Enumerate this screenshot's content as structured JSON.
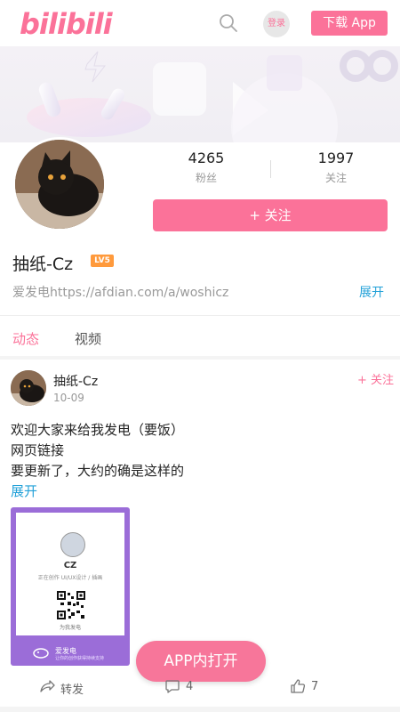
{
  "header": {
    "logo_text": "bilibili",
    "login_label": "登录",
    "download_label": "下载 App"
  },
  "profile": {
    "fans_count": "4265",
    "fans_label": "粉丝",
    "following_count": "1997",
    "following_label": "关注",
    "follow_button": "+ 关注",
    "username": "抽纸-Cz",
    "level": "LV5",
    "bio": "爱发电https://afdian.com/a/woshicz",
    "expand_label": "展开"
  },
  "tabs": [
    {
      "label": "动态",
      "active": true
    },
    {
      "label": "视频",
      "active": false
    }
  ],
  "post": {
    "author": "抽纸-Cz",
    "date": "10-09",
    "follow_label": "+ 关注",
    "lines": [
      "欢迎大家来给我发电（要饭）",
      "网页链接",
      "要更新了，大约的确是这样的"
    ],
    "expand_label": "展开",
    "card": {
      "name": "CZ",
      "subtitle": "正在创作 UI/UX设计 / 插画",
      "caption": "为我发电",
      "footer_title": "爱发电",
      "footer_sub": "让你的创作获得持续支持"
    },
    "actions": {
      "share_label": "转发",
      "comment_count": "4",
      "like_count": "7"
    }
  },
  "app_open_label": "APP内打开",
  "colors": {
    "brand": "#fb7299",
    "link": "#23a1d8",
    "level_badge": "#ff9a3c",
    "card_bg": "#9b6dd8"
  }
}
